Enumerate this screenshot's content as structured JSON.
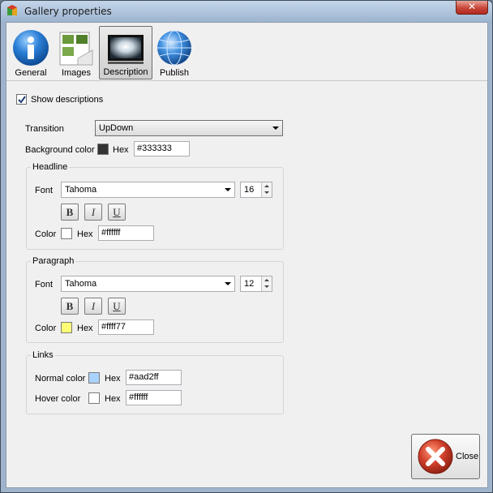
{
  "window": {
    "title": "Gallery properties",
    "close_glyph": "✕"
  },
  "toolbar": {
    "items": [
      {
        "label": "General",
        "icon": "info-icon",
        "selected": false
      },
      {
        "label": "Images",
        "icon": "images-icon",
        "selected": false
      },
      {
        "label": "Description",
        "icon": "description-icon",
        "selected": true
      },
      {
        "label": "Publish",
        "icon": "globe-icon",
        "selected": false
      }
    ]
  },
  "show_descriptions": {
    "label": "Show descriptions",
    "checked": true
  },
  "transition": {
    "label": "Transition",
    "value": "UpDown"
  },
  "background": {
    "label": "Background color",
    "hex_label": "Hex",
    "value": "#333333",
    "swatch": "#333333"
  },
  "headline": {
    "title": "Headline",
    "font_label": "Font",
    "font": "Tahoma",
    "size": "16",
    "bold": "B",
    "italic": "I",
    "underline": "U",
    "color_label": "Color",
    "hex_label": "Hex",
    "color": "#ffffff",
    "swatch": "#ffffff"
  },
  "paragraph": {
    "title": "Paragraph",
    "font_label": "Font",
    "font": "Tahoma",
    "size": "12",
    "bold": "B",
    "italic": "I",
    "underline": "U",
    "color_label": "Color",
    "hex_label": "Hex",
    "color": "#ffff77",
    "swatch": "#ffff77"
  },
  "links": {
    "title": "Links",
    "normal_label": "Normal color",
    "hex_label": "Hex",
    "normal": "#aad2ff",
    "normal_swatch": "#aad2ff",
    "hover_label": "Hover color",
    "hover": "#ffffff",
    "hover_swatch": "#ffffff"
  },
  "close_button": {
    "label": "Close"
  },
  "colors": {
    "accent_blue": "#2a7fd6",
    "close_red": "#d2412c",
    "selection": "#cfcfcf"
  }
}
